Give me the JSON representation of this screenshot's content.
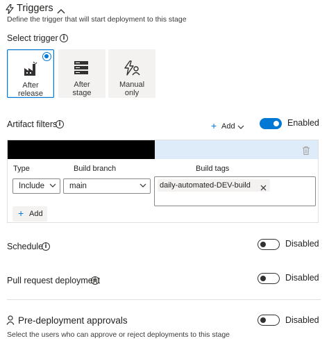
{
  "triggers": {
    "title": "Triggers",
    "description": "Define the trigger that will start deployment to this stage",
    "select_trigger_label": "Select trigger",
    "options": [
      {
        "line1": "After",
        "line2": "release",
        "icon": "factory-icon",
        "selected": true
      },
      {
        "line1": "After",
        "line2": "stage",
        "icon": "server-stack-icon",
        "selected": false
      },
      {
        "line1": "Manual",
        "line2": "only",
        "icon": "lightning-person-icon",
        "selected": false
      }
    ]
  },
  "artifact_filters": {
    "label": "Artifact filters",
    "add_label": "Add",
    "toggle_label": "Enabled",
    "enabled": true,
    "headers": {
      "type": "Type",
      "branch": "Build branch",
      "tags": "Build tags"
    },
    "row": {
      "type": "Include",
      "branch": "main",
      "tag": "daily-automated-DEV-build"
    },
    "add_row_label": "Add"
  },
  "schedule": {
    "label": "Schedule",
    "toggle_label": "Disabled",
    "enabled": false
  },
  "pull_request": {
    "label": "Pull request deployment",
    "toggle_label": "Disabled",
    "enabled": false
  },
  "approvals": {
    "title": "Pre-deployment approvals",
    "description": "Select the users who can approve or reject deployments to this stage",
    "toggle_label": "Disabled",
    "enabled": false
  },
  "colors": {
    "accent": "#0078d4",
    "header_band": "#deecf9",
    "redacted": "#000000"
  }
}
